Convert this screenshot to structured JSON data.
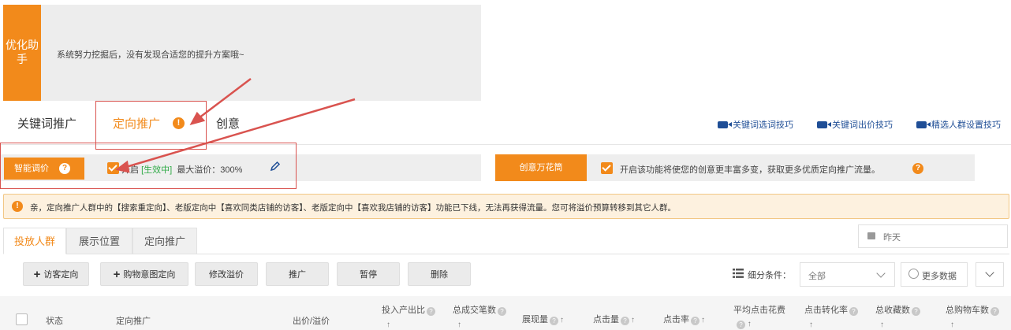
{
  "banner": {
    "badge": "优化助手",
    "message": "系统努力挖掘后，没有发现合适您的提升方案哦~"
  },
  "main_tabs": [
    {
      "label": "关键词推广"
    },
    {
      "label": "定向推广",
      "active": true
    },
    {
      "label": "创意"
    }
  ],
  "help_links": [
    {
      "label": "关键词选词技巧",
      "icon": "video-camera-icon"
    },
    {
      "label": "关键词出价技巧",
      "icon": "video-camera-icon"
    },
    {
      "label": "精选人群设置技巧",
      "icon": "video-camera-icon"
    }
  ],
  "smart_bid": {
    "label": "智能调价",
    "enabled_label": "开启",
    "status": "[生效中]",
    "max_premium": "最大溢价：300%"
  },
  "creative": {
    "label": "创意万花筒",
    "description": "开启该功能将使您的创意更丰富多变，获取更多优质定向推广流量。"
  },
  "notice": {
    "text": "亲，定向推广人群中的【搜索重定向】、老版定向中【喜欢同类店铺的访客】、老版定向中【喜欢我店铺的访客】功能已下线，无法再获得流量。您可将溢价预算转移到其它人群。"
  },
  "sub_tabs": [
    {
      "label": "投放人群",
      "active": true
    },
    {
      "label": "展示位置"
    },
    {
      "label": "定向推广"
    }
  ],
  "date_range": "昨天",
  "toolbar": {
    "visitor": "访客定向",
    "cart_intent": "购物意图定向",
    "modify_premium": "修改溢价",
    "promote": "推广",
    "pause": "暂停",
    "delete": "删除",
    "filter_label": "细分条件：",
    "filter_value": "全部",
    "more_data": "更多数据"
  },
  "table_header": {
    "status": "状态",
    "promotion": "定向推广",
    "bid": "出价/溢价",
    "roi": "投入产出比",
    "orders": "总成交笔数",
    "impressions": "展现量",
    "clicks": "点击量",
    "ctr": "点击率",
    "cpc": "平均点击花费",
    "cvr": "点击转化率",
    "favorites": "总收藏数",
    "cart": "总购物车数"
  },
  "colors": {
    "accent": "#f28a1b",
    "link": "#1f4e96",
    "annotation": "#d9534f",
    "active_status": "#2eaa45"
  }
}
